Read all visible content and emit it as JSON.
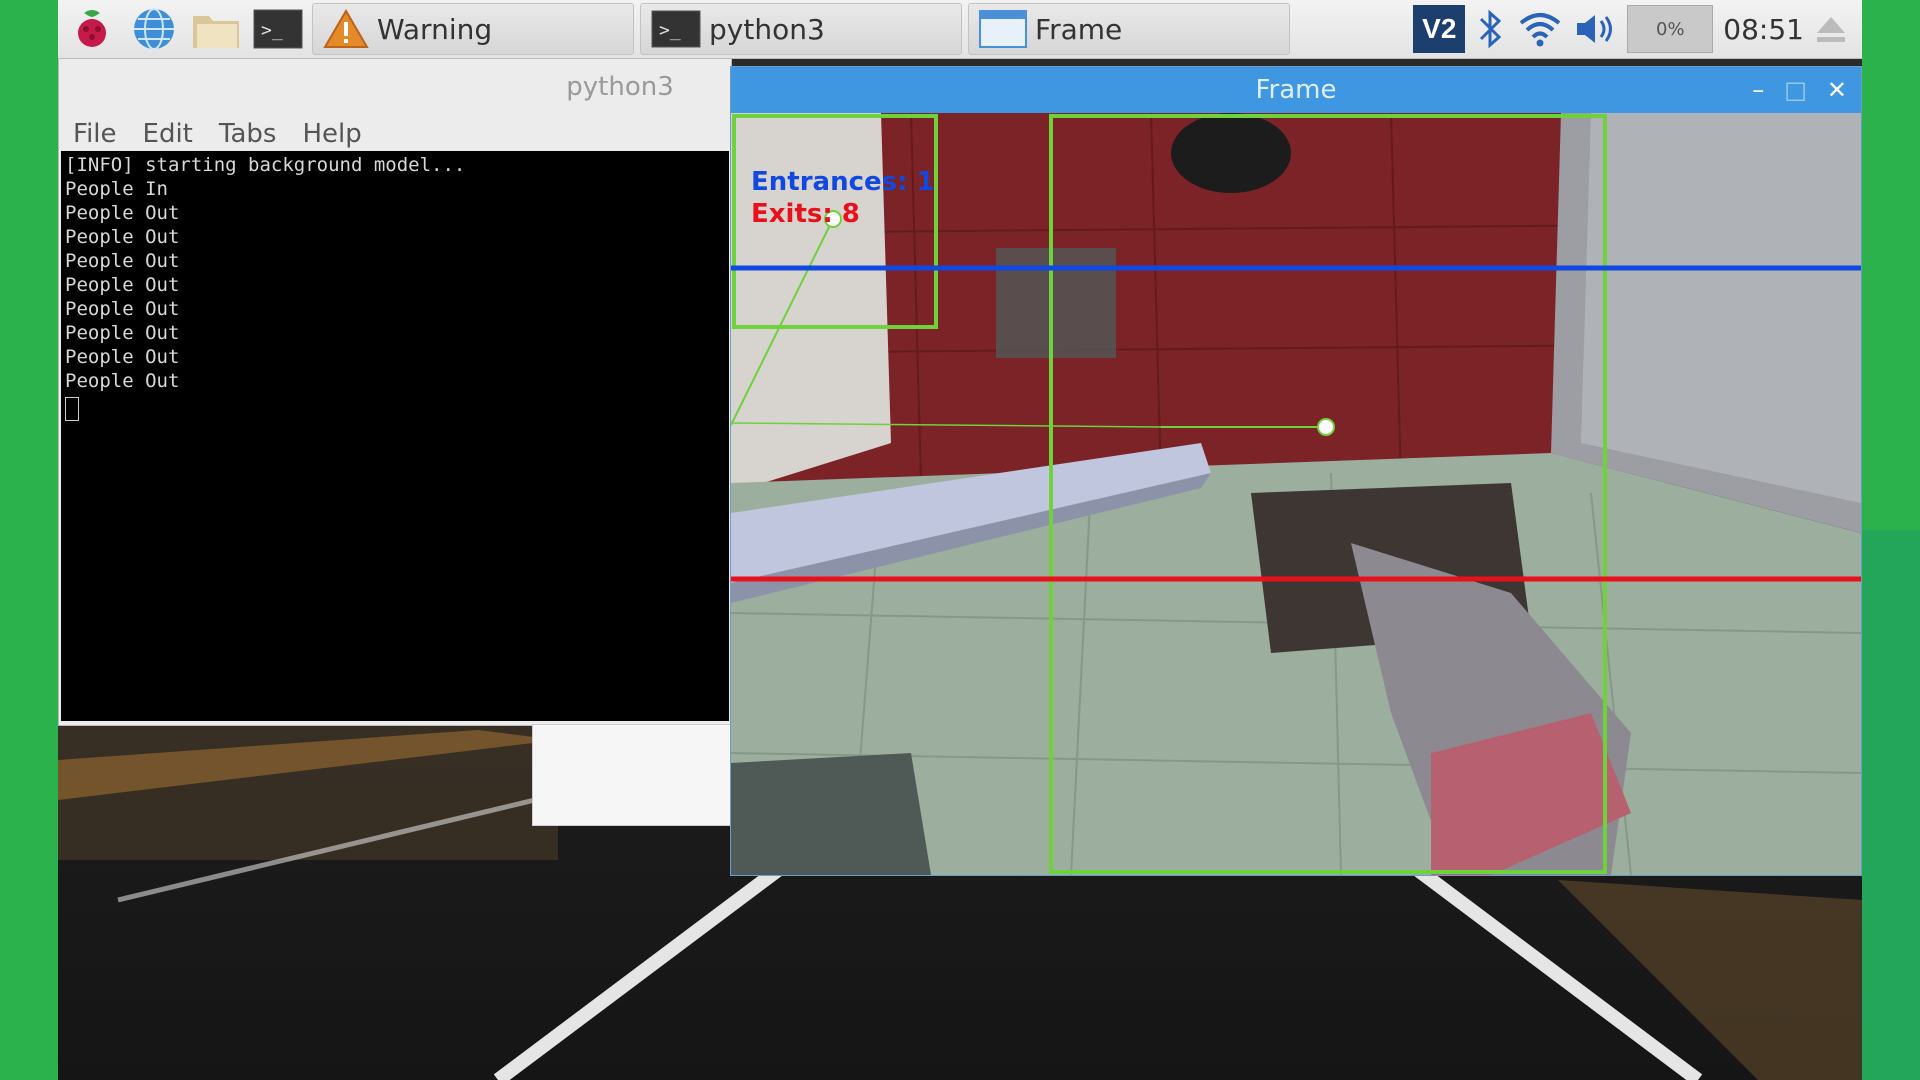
{
  "taskbar": {
    "tasks": [
      {
        "label": "Warning",
        "icon": "warning-icon"
      },
      {
        "label": "python3",
        "icon": "terminal-icon"
      },
      {
        "label": "Frame",
        "icon": "window-icon"
      }
    ],
    "clock": "08:51",
    "tray_badge": "0%"
  },
  "terminal": {
    "title": "python3",
    "menu": [
      "File",
      "Edit",
      "Tabs",
      "Help"
    ],
    "lines": [
      "[INFO] starting background model...",
      "People In",
      "People Out",
      "People Out",
      "People Out",
      "People Out",
      "People Out",
      "People Out",
      "People Out",
      "People Out"
    ]
  },
  "frame": {
    "title": "Frame",
    "entrances": "Entrances: 1",
    "exits": "Exits: 8"
  },
  "colors": {
    "accent_blue": "#3e97e0",
    "entrance_line": "#1048e0",
    "exit_line": "#e8101a",
    "tracker_box": "#6fd13b"
  }
}
